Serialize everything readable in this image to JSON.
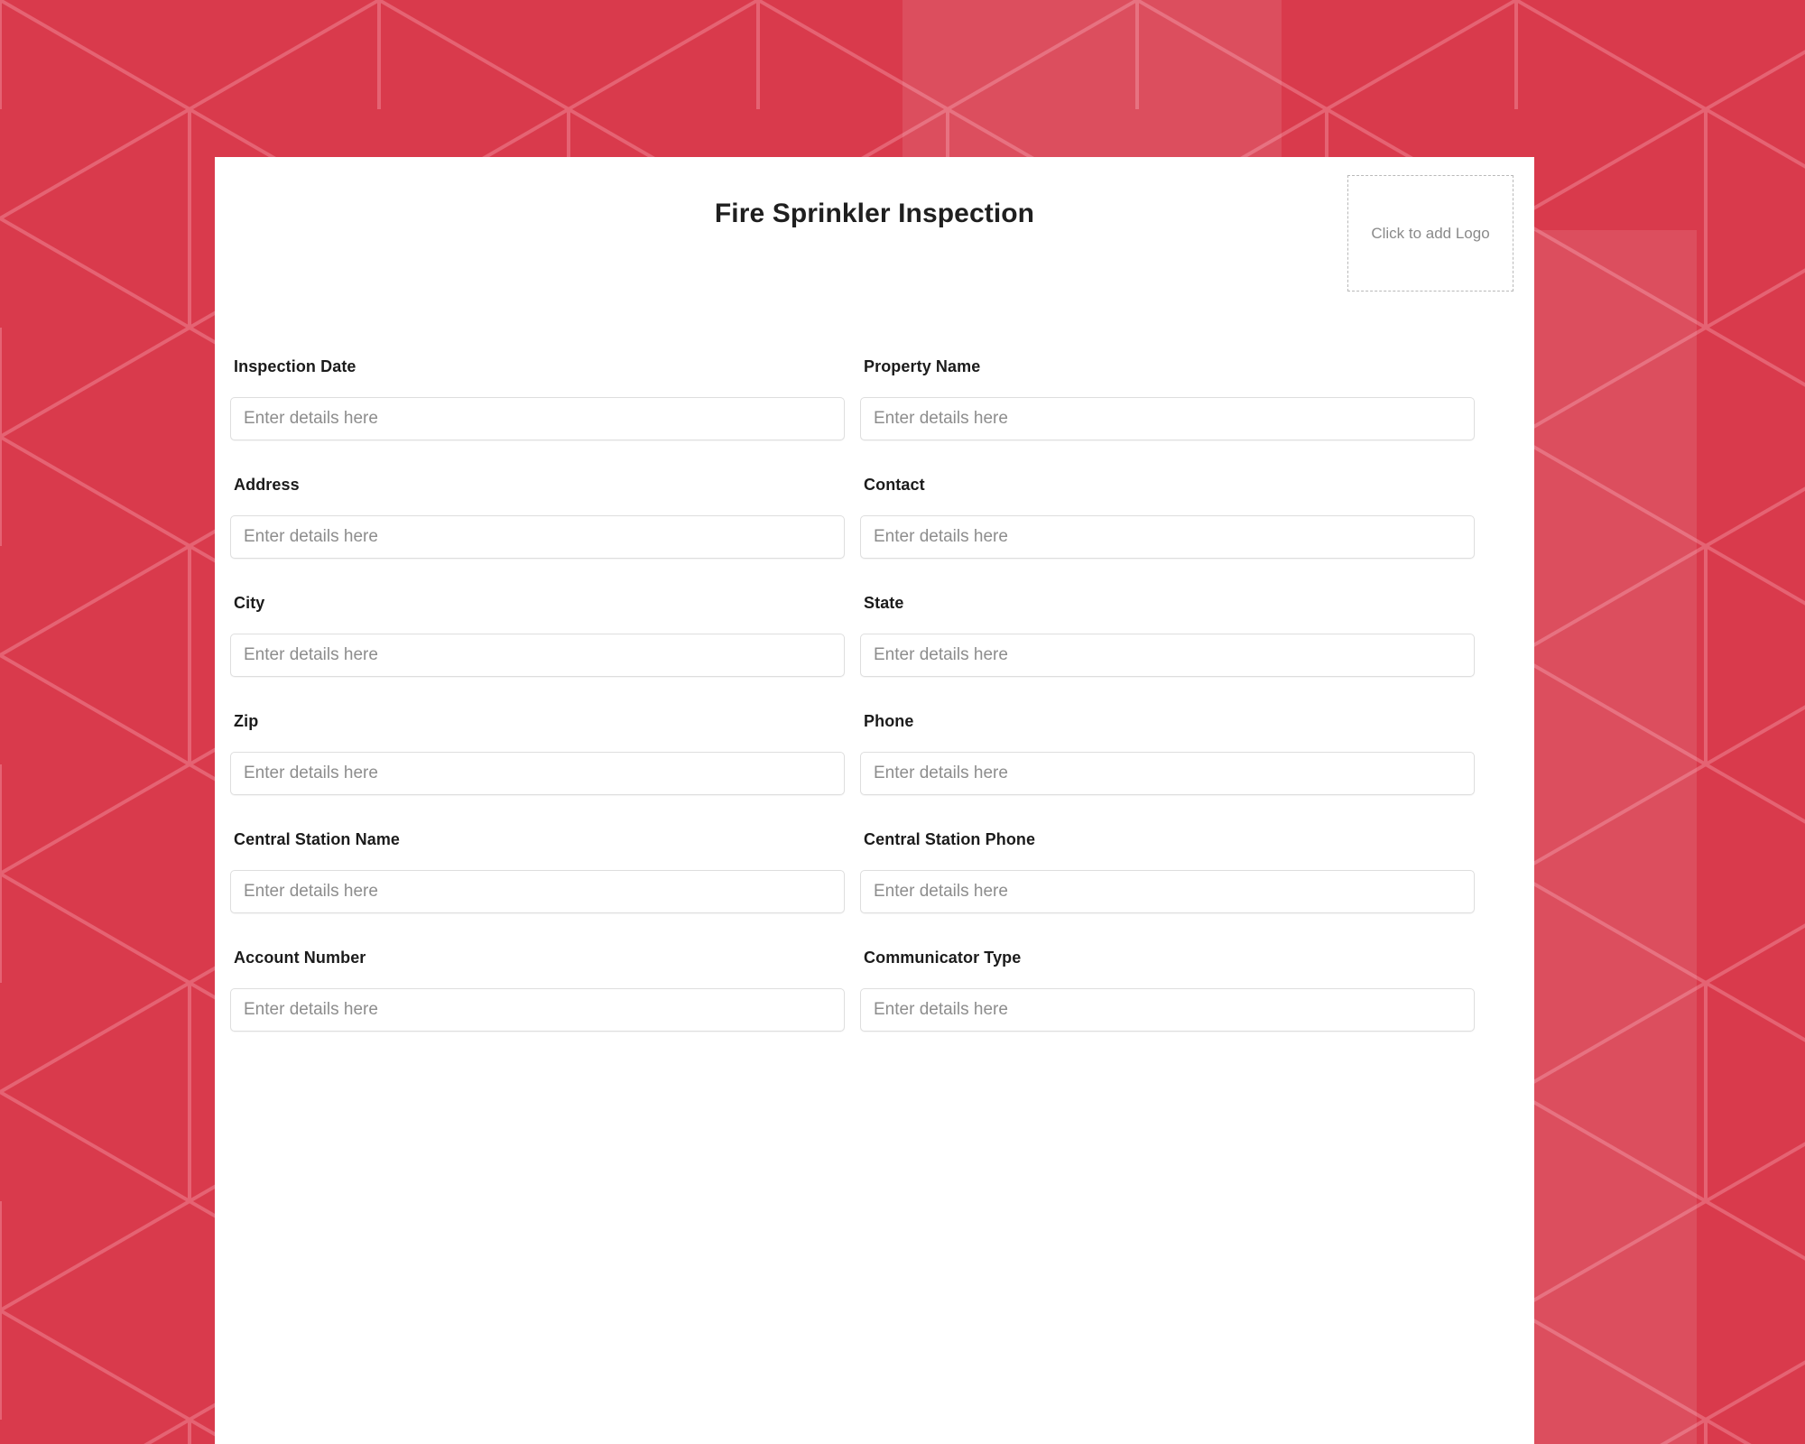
{
  "background": {
    "base_color": "#d93a4c",
    "line_color": "#e8697a",
    "pattern": "hexagon-cube-tessellation"
  },
  "card": {
    "background_color": "#ffffff"
  },
  "header": {
    "title": "Fire Sprinkler Inspection",
    "logo_placeholder": "Click to add Logo"
  },
  "form": {
    "placeholder": "Enter details here",
    "rows": [
      [
        {
          "label": "Inspection Date",
          "value": ""
        },
        {
          "label": "Property Name",
          "value": ""
        }
      ],
      [
        {
          "label": "Address",
          "value": ""
        },
        {
          "label": "Contact",
          "value": ""
        }
      ],
      [
        {
          "label": "City",
          "value": ""
        },
        {
          "label": "State",
          "value": ""
        }
      ],
      [
        {
          "label": "Zip",
          "value": ""
        },
        {
          "label": "Phone",
          "value": ""
        }
      ],
      [
        {
          "label": "Central Station Name",
          "value": ""
        },
        {
          "label": "Central Station Phone",
          "value": ""
        }
      ],
      [
        {
          "label": "Account Number",
          "value": ""
        },
        {
          "label": "Communicator Type",
          "value": ""
        }
      ]
    ]
  }
}
